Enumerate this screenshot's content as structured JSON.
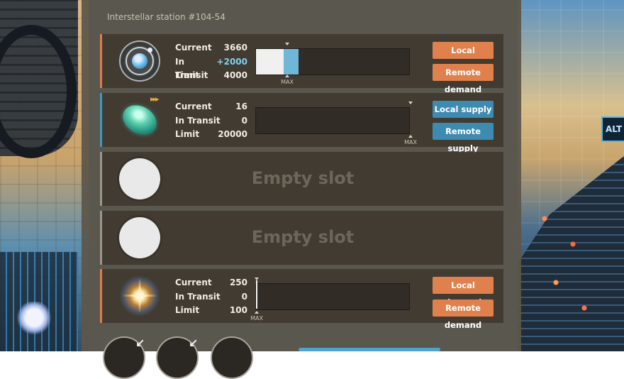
{
  "station": {
    "title": "Interstellar station #104-54"
  },
  "slots": [
    {
      "mode": "demand",
      "icon": "orbit-icon",
      "labels": {
        "current": "Current",
        "in_transit": "In Transit",
        "limit": "Limit"
      },
      "current": "3660",
      "in_transit": "+2000",
      "limit": "4000",
      "fill_fraction": 0.915,
      "transit_fraction": 0.5,
      "max_label": "MAX",
      "buttons": {
        "local": "Local demand",
        "remote": "Remote demand"
      }
    },
    {
      "mode": "supply",
      "icon": "crystal-icon",
      "speed_tag": "▸▸▸",
      "labels": {
        "current": "Current",
        "in_transit": "In Transit",
        "limit": "Limit"
      },
      "current": "16",
      "in_transit": "0",
      "limit": "20000",
      "fill_fraction": 0.0008,
      "max_label": "MAX",
      "buttons": {
        "local": "Local supply",
        "remote": "Remote supply"
      }
    },
    {
      "mode": "empty",
      "icon": "empty-slot-icon",
      "label": "Empty slot"
    },
    {
      "mode": "empty",
      "icon": "empty-slot-icon",
      "label": "Empty slot"
    },
    {
      "mode": "demand",
      "icon": "starburst-icon",
      "labels": {
        "current": "Current",
        "in_transit": "In Transit",
        "limit": "Limit"
      },
      "current": "250",
      "in_transit": "0",
      "limit": "100",
      "fill_fraction": 1.0,
      "max_label": "MAX",
      "buttons": {
        "local": "Local demand",
        "remote": "Remote demand"
      }
    }
  ],
  "overlay": {
    "alt_badge": "ALT"
  },
  "colors": {
    "demand": "#e0814d",
    "supply": "#3e8bb1",
    "transit": "#6fb7d9"
  }
}
